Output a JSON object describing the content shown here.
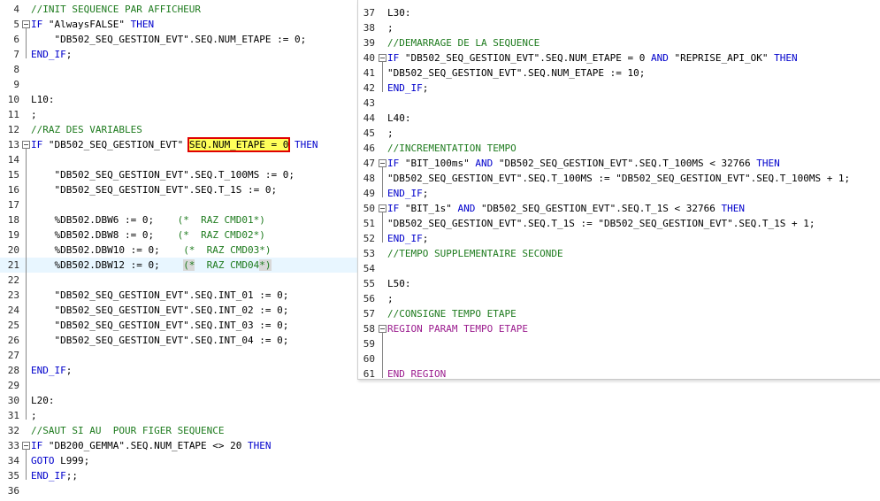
{
  "left_lines": [
    {
      "n": "4",
      "code": "//INIT SEQUENCE PAR AFFICHEUR",
      "type": "comment"
    },
    {
      "n": "5",
      "code": "IF \"AlwaysFALSE\" THEN",
      "type": "if",
      "fold": true
    },
    {
      "n": "6",
      "code": "    \"DB502_SEQ_GESTION_EVT\".SEQ.NUM_ETAPE := 0;",
      "type": "plain"
    },
    {
      "n": "7",
      "code": "END_IF;",
      "type": "kw"
    },
    {
      "n": "8",
      "code": "",
      "type": "plain"
    },
    {
      "n": "9",
      "code": "",
      "type": "plain"
    },
    {
      "n": "10",
      "code": "L10:",
      "type": "plain"
    },
    {
      "n": "11",
      "code": ";",
      "type": "plain"
    },
    {
      "n": "12",
      "code": "//RAZ DES VARIABLES",
      "type": "comment"
    },
    {
      "n": "13",
      "code": "",
      "type": "special13",
      "fold": true
    },
    {
      "n": "14",
      "code": "",
      "type": "plain"
    },
    {
      "n": "15",
      "code": "    \"DB502_SEQ_GESTION_EVT\".SEQ.T_100MS := 0;",
      "type": "plain"
    },
    {
      "n": "16",
      "code": "    \"DB502_SEQ_GESTION_EVT\".SEQ.T_1S := 0;",
      "type": "plain"
    },
    {
      "n": "17",
      "code": "",
      "type": "plain"
    },
    {
      "n": "18",
      "code": "    %DB502.DBW6 := 0;    (*  RAZ CMD01*)",
      "type": "dbw"
    },
    {
      "n": "19",
      "code": "    %DB502.DBW8 := 0;    (*  RAZ CMD02*)",
      "type": "dbw"
    },
    {
      "n": "20",
      "code": "    %DB502.DBW10 := 0;    (*  RAZ CMD03*)",
      "type": "dbw"
    },
    {
      "n": "21",
      "code": "",
      "type": "special21"
    },
    {
      "n": "22",
      "code": "",
      "type": "plain"
    },
    {
      "n": "23",
      "code": "    \"DB502_SEQ_GESTION_EVT\".SEQ.INT_01 := 0;",
      "type": "plain"
    },
    {
      "n": "24",
      "code": "    \"DB502_SEQ_GESTION_EVT\".SEQ.INT_02 := 0;",
      "type": "plain"
    },
    {
      "n": "25",
      "code": "    \"DB502_SEQ_GESTION_EVT\".SEQ.INT_03 := 0;",
      "type": "plain"
    },
    {
      "n": "26",
      "code": "    \"DB502_SEQ_GESTION_EVT\".SEQ.INT_04 := 0;",
      "type": "plain"
    },
    {
      "n": "27",
      "code": "",
      "type": "plain"
    },
    {
      "n": "28",
      "code": "END_IF;",
      "type": "kw"
    },
    {
      "n": "29",
      "code": "",
      "type": "plain"
    },
    {
      "n": "30",
      "code": "L20:",
      "type": "plain"
    },
    {
      "n": "31",
      "code": ";",
      "type": "plain"
    },
    {
      "n": "32",
      "code": "//SAUT SI AU  POUR FIGER SEQUENCE",
      "type": "comment"
    },
    {
      "n": "33",
      "code": "",
      "type": "special33",
      "fold": true
    },
    {
      "n": "34",
      "code": "GOTO L999;",
      "type": "plain"
    },
    {
      "n": "35",
      "code": "END_IF;;",
      "type": "kw"
    },
    {
      "n": "36",
      "code": "",
      "type": "plain"
    }
  ],
  "line13": {
    "pre": "IF \"DB502_SEQ_GESTION_EVT\"",
    "boxed": "SEQ.NUM_ETAPE = 0",
    "post": "THEN"
  },
  "line21": {
    "pre": "    %DB502.DBW12 := 0;    ",
    "gray1": "(*",
    "mid": "  RAZ CMD04",
    "gray2": "*)"
  },
  "line33": {
    "pre": "IF \"DB200_GEMMA\".SEQ.NUM_ETAPE <> 20 ",
    "post": "THEN"
  },
  "right_lines": [
    {
      "n": "37",
      "code": "L30:",
      "type": "plain"
    },
    {
      "n": "38",
      "code": ";",
      "type": "plain"
    },
    {
      "n": "39",
      "code": "//DEMARRAGE DE LA SEQUENCE",
      "type": "comment"
    },
    {
      "n": "40",
      "code": "IF \"DB502_SEQ_GESTION_EVT\".SEQ.NUM_ETAPE = 0 AND \"REPRISE_API_OK\" THEN",
      "type": "if",
      "fold": true
    },
    {
      "n": "41",
      "code": "\"DB502_SEQ_GESTION_EVT\".SEQ.NUM_ETAPE := 10;",
      "type": "plain"
    },
    {
      "n": "42",
      "code": "END_IF;",
      "type": "kw"
    },
    {
      "n": "43",
      "code": "",
      "type": "plain"
    },
    {
      "n": "44",
      "code": "L40:",
      "type": "plain"
    },
    {
      "n": "45",
      "code": ";",
      "type": "plain"
    },
    {
      "n": "46",
      "code": "//INCREMENTATION TEMPO",
      "type": "comment"
    },
    {
      "n": "47",
      "code": "IF \"BIT_100ms\" AND \"DB502_SEQ_GESTION_EVT\".SEQ.T_100MS < 32766 THEN",
      "type": "if",
      "fold": true
    },
    {
      "n": "48",
      "code": "\"DB502_SEQ_GESTION_EVT\".SEQ.T_100MS := \"DB502_SEQ_GESTION_EVT\".SEQ.T_100MS + 1;",
      "type": "plain"
    },
    {
      "n": "49",
      "code": "END_IF;",
      "type": "kw"
    },
    {
      "n": "50",
      "code": "IF \"BIT_1s\" AND \"DB502_SEQ_GESTION_EVT\".SEQ.T_1S < 32766 THEN",
      "type": "if",
      "fold": true
    },
    {
      "n": "51",
      "code": "\"DB502_SEQ_GESTION_EVT\".SEQ.T_1S := \"DB502_SEQ_GESTION_EVT\".SEQ.T_1S + 1;",
      "type": "plain"
    },
    {
      "n": "52",
      "code": "END_IF;",
      "type": "kw"
    },
    {
      "n": "53",
      "code": "//TEMPO SUPPLEMENTAIRE SECONDE",
      "type": "comment"
    },
    {
      "n": "54",
      "code": "",
      "type": "plain"
    },
    {
      "n": "55",
      "code": "L50:",
      "type": "plain"
    },
    {
      "n": "56",
      "code": ";",
      "type": "plain"
    },
    {
      "n": "57",
      "code": "//CONSIGNE TEMPO ETAPE",
      "type": "comment"
    },
    {
      "n": "58",
      "code": "REGION PARAM TEMPO ETAPE",
      "type": "region",
      "fold": true
    },
    {
      "n": "59",
      "code": "",
      "type": "plain"
    },
    {
      "n": "60",
      "code": "",
      "type": "plain"
    },
    {
      "n": "61",
      "code": "END_REGION",
      "type": "region"
    }
  ]
}
